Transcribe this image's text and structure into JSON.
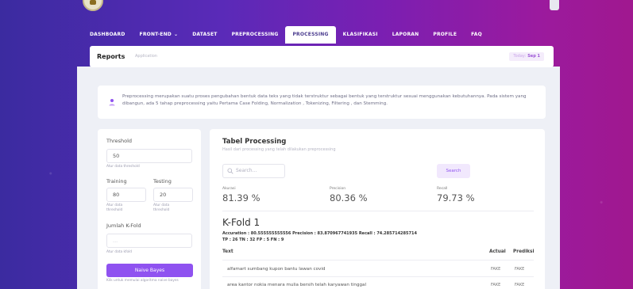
{
  "nav": {
    "items": [
      {
        "label": "DASHBOARD"
      },
      {
        "label": "FRONT-END",
        "has_dropdown": true
      },
      {
        "label": "DATASET"
      },
      {
        "label": "PREPROCESSING"
      },
      {
        "label": "PROCESSING",
        "active": true
      },
      {
        "label": "KLASIFIKASI"
      },
      {
        "label": "LAPORAN"
      },
      {
        "label": "PROFILE"
      },
      {
        "label": "FAQ"
      }
    ],
    "chevron": "⌄"
  },
  "reports": {
    "title": "Reports",
    "subtitle": "Application",
    "today_label": "Today:",
    "today_value": "Sep 1"
  },
  "info": {
    "icon": "info-person-icon",
    "text": "Preprocessing merupakan suatu proses pengubahan bentuk data teks yang tidak terstruktur sebagai bentuk yang terstruktur sesuai menggunakan kebutuhannya. Pada sistem yang dibangun, ada 5 tahap preprocessing yaitu Pertama Case Folding, Normalization , Tokenizing, Filtering , dan Stemming."
  },
  "sidebar": {
    "threshold_label": "Threshold",
    "threshold_value": "50",
    "threshold_hint": "Atur data threshold",
    "training_label": "Training",
    "training_value": "80",
    "training_hint": "Atur data threshold",
    "testing_label": "Testing",
    "testing_value": "20",
    "testing_hint": "Atur data threshold",
    "kfold_label": "Jumlah K-Fold",
    "kfold_value": "",
    "kfold_placeholder": "...",
    "kfold_hint": "Atur data kfold",
    "button_label": "Naive Bayes",
    "button_hint": "Klik untuk memulai algoritma naive bayes"
  },
  "table_panel": {
    "title": "Tabel Processing",
    "subtitle": "Hasil dari processing yang telah dilakukan preprocessing",
    "search_placeholder": "Search...",
    "search_button": "Search",
    "metrics": [
      {
        "label": "Akurasi",
        "value": "81.39 %"
      },
      {
        "label": "Precision",
        "value": "80.36 %"
      },
      {
        "label": "Recall",
        "value": "79.73 %"
      }
    ],
    "kfold_title": "K-Fold 1",
    "kfold_stats_line1": "Accuration : 80.555555555556   Precision : 83.870967741935   Recall : 74.285714285714",
    "kfold_stats_line2": "TP : 26    TN : 32    FP : 5    FN : 9",
    "columns": [
      "Text",
      "Actual",
      "Prediksi"
    ],
    "rows": [
      {
        "text": "alfamart sumbang kupon bantu lawan covid",
        "actual": "FAKE",
        "prediksi": "FAKE"
      },
      {
        "text": "area kantor nokia menara mulia bersih telah karyawan tinggal",
        "actual": "FAKE",
        "prediksi": "FAKE"
      }
    ]
  },
  "colors": {
    "accent": "#8f52f0",
    "header_gradient_start": "#3b2ba0",
    "header_gradient_end": "#a0188f"
  }
}
